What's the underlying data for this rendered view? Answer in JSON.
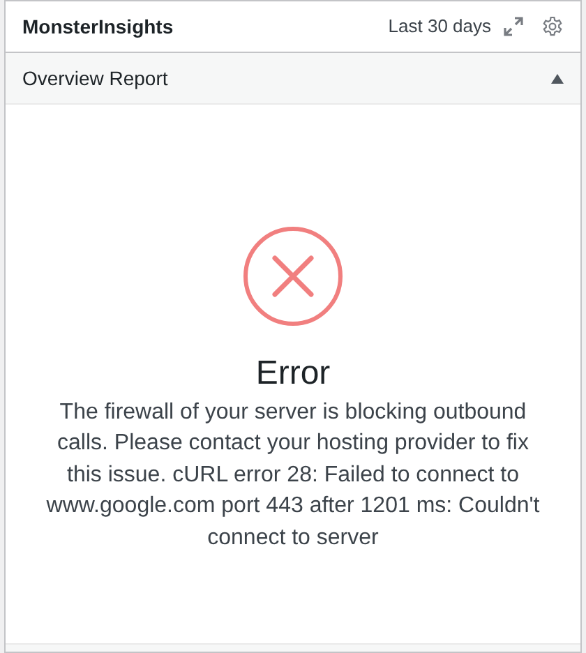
{
  "widget": {
    "title": "MonsterInsights",
    "date_range": "Last 30 days"
  },
  "section": {
    "title": "Overview Report",
    "expanded": true
  },
  "error": {
    "title": "Error",
    "message": "The firewall of your server is blocking outbound calls. Please contact your hosting provider to fix this issue. cURL error 28: Failed to connect to www.google.com port 443 after 1201 ms: Couldn't connect to server"
  }
}
